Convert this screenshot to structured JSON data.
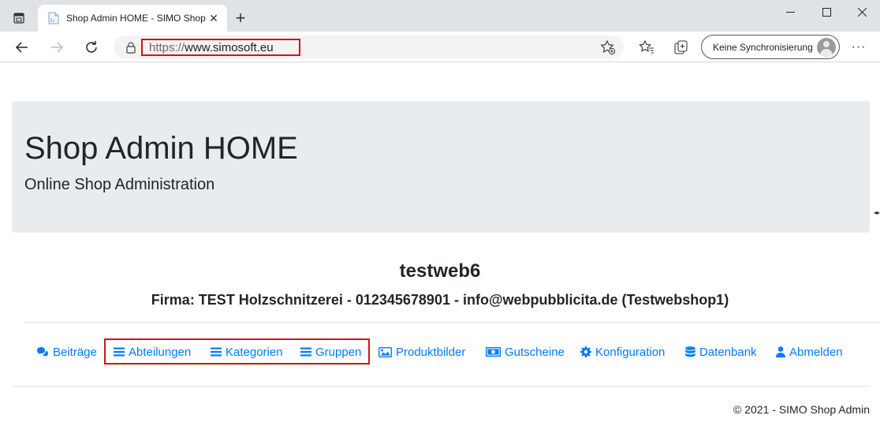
{
  "browser": {
    "tab_title": "Shop Admin HOME - SIMO Shop",
    "url_protocol": "https://",
    "url_host": "www.simosoft.eu",
    "sync_label": "Keine Synchronisierung",
    "more_label": "···"
  },
  "page": {
    "jumbotron_title": "Shop Admin HOME",
    "jumbotron_lead": "Online Shop Administration",
    "shop_name": "testweb6",
    "company_line": "Firma: TEST Holzschnitzerei - 012345678901 - info@webpubblicita.de (Testwebshop1)",
    "footer": "© 2021 - SIMO Shop Admin"
  },
  "nav": [
    {
      "label": "Beiträge",
      "icon": "comments-icon"
    },
    {
      "label": "Abteilungen",
      "icon": "list-icon"
    },
    {
      "label": "Kategorien",
      "icon": "list-icon"
    },
    {
      "label": "Gruppen",
      "icon": "list-icon"
    },
    {
      "label": "Produktbilder",
      "icon": "image-icon"
    },
    {
      "label": "Gutscheine",
      "icon": "money-bill-icon"
    },
    {
      "label": "Konfiguration",
      "icon": "gear-icon"
    },
    {
      "label": "Datenbank",
      "icon": "database-icon"
    },
    {
      "label": "Abmelden",
      "icon": "user-icon"
    }
  ],
  "colors": {
    "link": "#007bff",
    "highlight": "#d0141b",
    "jumbotron_bg": "#e9ecef"
  }
}
